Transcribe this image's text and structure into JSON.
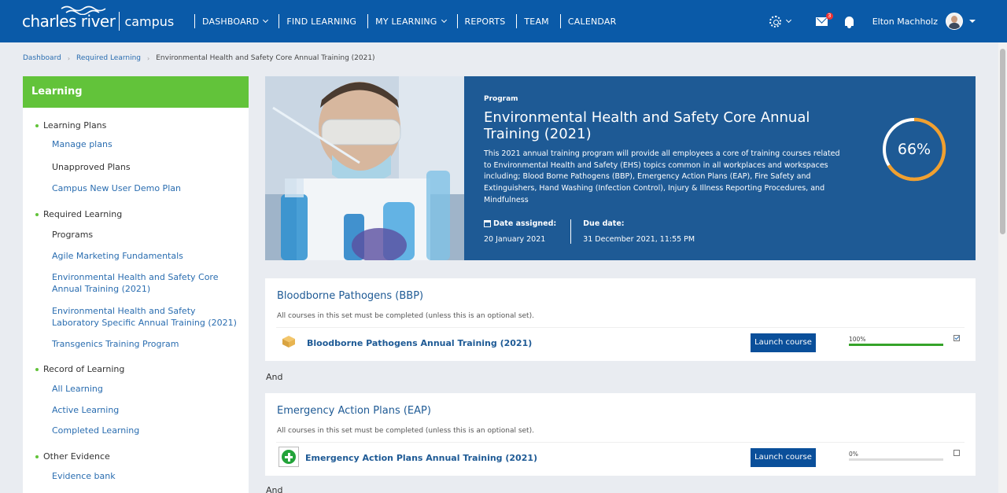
{
  "header": {
    "brand": "charles river",
    "product": "campus",
    "nav": [
      {
        "label": "DASHBOARD",
        "dropdown": true
      },
      {
        "label": "FIND LEARNING",
        "dropdown": false
      },
      {
        "label": "MY LEARNING",
        "dropdown": true
      },
      {
        "label": "REPORTS",
        "dropdown": false
      },
      {
        "label": "TEAM",
        "dropdown": false
      },
      {
        "label": "CALENDAR",
        "dropdown": false
      }
    ],
    "messages_count": "3",
    "user_name": "Elton Machholz"
  },
  "breadcrumb": {
    "items": [
      "Dashboard",
      "Required Learning"
    ],
    "current": "Environmental Health and Safety Core Annual Training (2021)"
  },
  "sidebar": {
    "title": "Learning",
    "sections": [
      {
        "label": "Learning Plans",
        "items": [
          "Manage plans",
          "Unapproved Plans",
          "Campus New User Demo Plan"
        ]
      },
      {
        "label": "Required Learning",
        "items": [
          "Programs",
          "Agile Marketing Fundamentals",
          "Environmental Health and Safety Core Annual Training (2021)",
          "Environmental Health and Safety Laboratory Specific Annual Training (2021)",
          "Transgenics Training Program"
        ]
      },
      {
        "label": "Record of Learning",
        "items": [
          "All Learning",
          "Active Learning",
          "Completed Learning"
        ]
      },
      {
        "label": "Other Evidence",
        "items": [
          "Evidence bank"
        ]
      }
    ]
  },
  "program": {
    "eyebrow": "Program",
    "title": "Environmental Health and Safety Core Annual Training (2021)",
    "description": "This 2021 annual training program will provide all employees a core of training courses related to Environmental Health and Safety (EHS) topics common in all workplaces and workspaces including; Blood Borne Pathogens (BBP), Emergency Action Plans (EAP), Fire Safety and Extinguishers, Hand Washing (Infection Control), Injury & Illness Reporting Procedures, and Mindfulness",
    "date_assigned_label": "Date assigned:",
    "date_assigned": "20 January 2021",
    "due_date_label": "Due date:",
    "due_date": "31 December 2021, 11:55 PM",
    "progress_text": "66%",
    "progress_value": 0.66,
    "ring_color": "#f0a030"
  },
  "course_sets": [
    {
      "title": "Bloodborne Pathogens (BBP)",
      "subtitle": "All courses in this set must be completed (unless this is an optional set).",
      "course": "Bloodborne Pathogens Annual Training (2021)",
      "icon": "package-icon",
      "launch_label": "Launch course",
      "progress_text": "100%",
      "progress_value": 1.0,
      "completed": true
    },
    {
      "title": "Emergency Action Plans (EAP)",
      "subtitle": "All courses in this set must be completed (unless this is an optional set).",
      "course": "Emergency Action Plans Annual Training (2021)",
      "icon": "first-aid-icon",
      "launch_label": "Launch course",
      "progress_text": "0%",
      "progress_value": 0.0,
      "completed": false
    }
  ],
  "connector": "And"
}
